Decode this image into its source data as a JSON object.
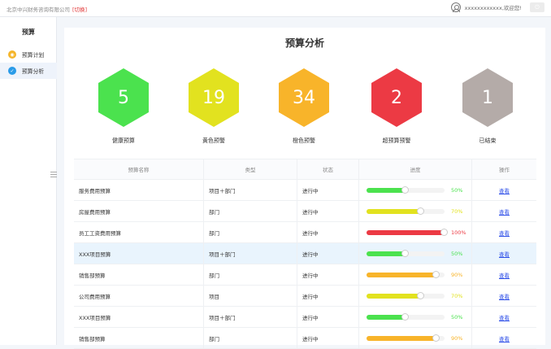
{
  "topbar": {
    "company": "北京中兴财务咨询有限公司",
    "switch_label": "[切换]",
    "welcome": "xxxxxxxxxxxx,欢迎您!",
    "power_icon": "power-icon"
  },
  "sidebar": {
    "title": "预算",
    "items": [
      {
        "label": "预算计划",
        "icon": "plan-icon",
        "color": "#f5b52a"
      },
      {
        "label": "预算分析",
        "icon": "analysis-icon",
        "color": "#2a9be8"
      }
    ]
  },
  "main": {
    "title": "预算分析",
    "stats": [
      {
        "value": "5",
        "label": "健康预算",
        "color": "#4be24e"
      },
      {
        "value": "19",
        "label": "黄色预警",
        "color": "#e2e21f"
      },
      {
        "value": "34",
        "label": "橙色预警",
        "color": "#f8b42a"
      },
      {
        "value": "2",
        "label": "超预算预警",
        "color": "#ec3a44"
      },
      {
        "value": "1",
        "label": "已结束",
        "color": "#b4aba8"
      }
    ],
    "table": {
      "headers": [
        "预算名称",
        "类型",
        "状态",
        "进度",
        "操作"
      ],
      "rows": [
        {
          "name": "服务费用预算",
          "type": "项目＋部门",
          "status": "进行中",
          "progress": 50,
          "pct": "50%",
          "color": "#4be24e",
          "action": "查看"
        },
        {
          "name": "房屋费用预算",
          "type": "部门",
          "status": "进行中",
          "progress": 70,
          "pct": "70%",
          "color": "#e2e21f",
          "action": "查看"
        },
        {
          "name": "员工工资费用预算",
          "type": "部门",
          "status": "进行中",
          "progress": 100,
          "pct": "100%",
          "color": "#ec3a44",
          "action": "查看"
        },
        {
          "name": "XXX项目预算",
          "type": "项目＋部门",
          "status": "进行中",
          "progress": 50,
          "pct": "50%",
          "color": "#4be24e",
          "action": "查看"
        },
        {
          "name": "销售部预算",
          "type": "部门",
          "status": "进行中",
          "progress": 90,
          "pct": "90%",
          "color": "#f8b42a",
          "action": "查看"
        },
        {
          "name": "公司费用预算",
          "type": "项目",
          "status": "进行中",
          "progress": 70,
          "pct": "70%",
          "color": "#e2e21f",
          "action": "查看"
        },
        {
          "name": "XXX项目预算",
          "type": "项目＋部门",
          "status": "进行中",
          "progress": 50,
          "pct": "50%",
          "color": "#4be24e",
          "action": "查看"
        },
        {
          "name": "销售部预算",
          "type": "部门",
          "status": "进行中",
          "progress": 90,
          "pct": "90%",
          "color": "#f8b42a",
          "action": "查看"
        }
      ]
    }
  }
}
